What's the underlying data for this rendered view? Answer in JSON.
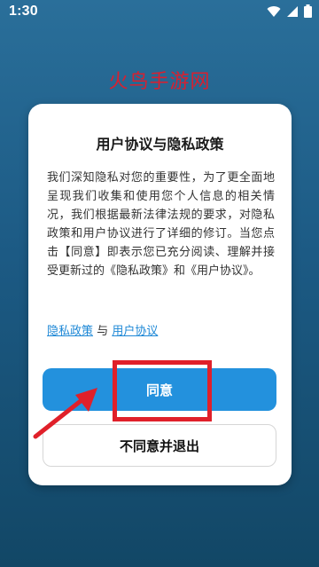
{
  "status_bar": {
    "time": "1:30",
    "icons": [
      "wifi-icon",
      "signal-icon",
      "battery-icon"
    ]
  },
  "watermark": "火鸟手游网",
  "dialog": {
    "title": "用户协议与隐私政策",
    "body": "我们深知隐私对您的重要性，为了更全面地呈现我们收集和使用您个人信息的相关情况，我们根据最新法律法规的要求，对隐私政策和用户协议进行了详细的修订。当您点击【同意】即表示您已充分阅读、理解并接受更新过的《隐私政策》和《用户协议》。",
    "privacy_link": "隐私政策",
    "link_separator": "与",
    "terms_link": "用户协议",
    "agree_label": "同意",
    "disagree_label": "不同意并退出"
  },
  "colors": {
    "accent": "#2391dd",
    "annotation": "#e0202a",
    "watermark": "#e11d2b"
  }
}
